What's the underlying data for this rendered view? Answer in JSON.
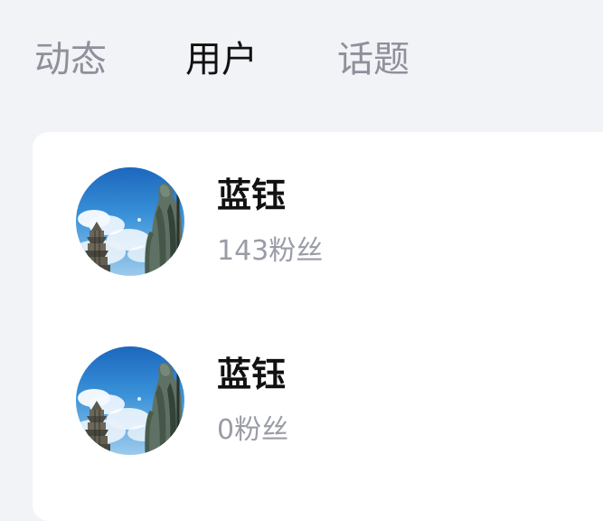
{
  "tabs": [
    {
      "label": "动态",
      "active": false
    },
    {
      "label": "用户",
      "active": true
    },
    {
      "label": "话题",
      "active": false
    }
  ],
  "users": [
    {
      "name": "蓝钰",
      "fans": "143粉丝",
      "avatar_icon": "avatar-icon"
    },
    {
      "name": "蓝钰",
      "fans": "0粉丝",
      "avatar_icon": "avatar-icon"
    }
  ],
  "colors": {
    "background": "#f2f3f7",
    "card": "#ffffff",
    "active_tab": "#111111",
    "inactive_tab": "#8e909b",
    "secondary_text": "#9a9ca6",
    "sky": "#2f86d2"
  }
}
